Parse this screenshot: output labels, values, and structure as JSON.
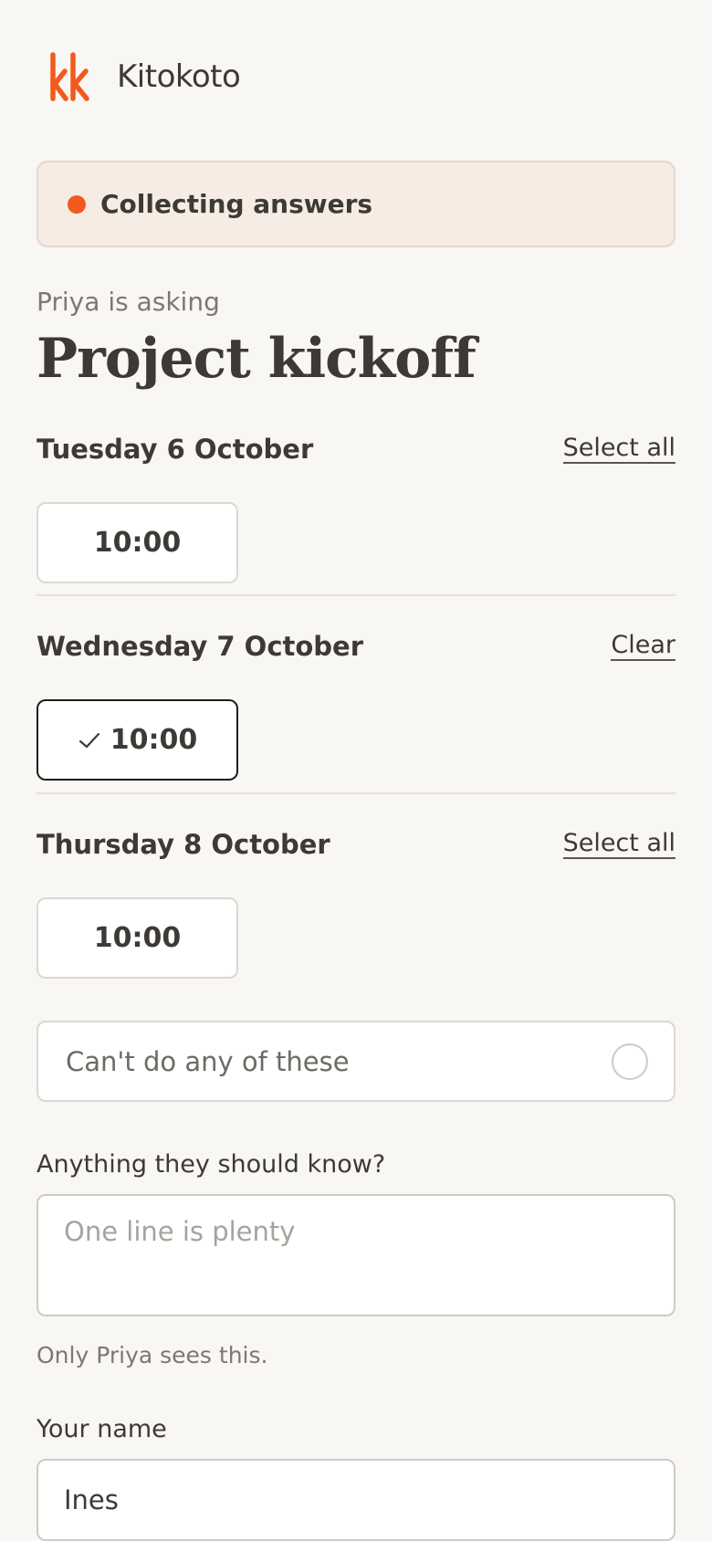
{
  "header": {
    "brand": "Kitokoto",
    "logo_color": "#f25a1d"
  },
  "status": {
    "label": "Collecting answers",
    "dot_color": "#f25a1d"
  },
  "poll": {
    "asker": "Priya is asking",
    "title": "Project kickoff"
  },
  "days": [
    {
      "name": "Tuesday 6 October",
      "action": "Select all",
      "slots": [
        {
          "time": "10:00",
          "selected": false
        }
      ]
    },
    {
      "name": "Wednesday 7 October",
      "action": "Clear",
      "slots": [
        {
          "time": "10:00",
          "selected": true
        }
      ]
    },
    {
      "name": "Thursday 8 October",
      "action": "Select all",
      "slots": [
        {
          "time": "10:00",
          "selected": false
        }
      ]
    }
  ],
  "none_option": {
    "label": "Can't do any of these",
    "checked": false
  },
  "note": {
    "label": "Anything they should know?",
    "placeholder": "One line is plenty",
    "value": "",
    "hint": "Only Priya sees this."
  },
  "name": {
    "label": "Your name",
    "value": "Ines"
  }
}
